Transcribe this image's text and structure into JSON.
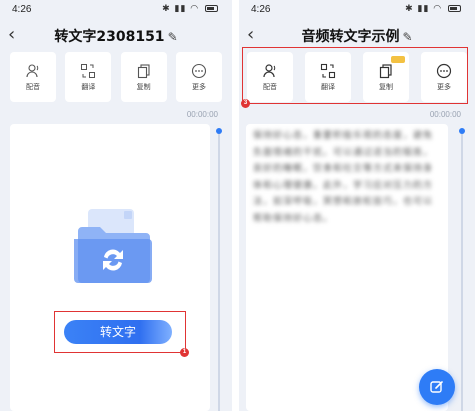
{
  "left_screen": {
    "status_time": "4:26",
    "title": "转文字2308151",
    "toolbar": [
      {
        "label": "配音",
        "icon": "person-voice-icon"
      },
      {
        "label": "翻译",
        "icon": "translate-icon"
      },
      {
        "label": "复制",
        "icon": "copy-icon"
      },
      {
        "label": "更多",
        "icon": "more-icon"
      }
    ],
    "timestamp": "00:00:00",
    "convert_label": "转文字",
    "badge": "1"
  },
  "right_screen": {
    "status_time": "4:26",
    "title": "音频转文字示例",
    "toolbar": [
      {
        "label": "配音",
        "icon": "person-voice-icon"
      },
      {
        "label": "翻译",
        "icon": "translate-icon"
      },
      {
        "label": "复制",
        "icon": "copy-icon"
      },
      {
        "label": "更多",
        "icon": "more-icon"
      }
    ],
    "timestamp": "00:00:00",
    "transcript": "保持好心态，重要积极乐观的态度，避免负面情绪的干扰。可以通过适当的锻炼，良好的睡眠，饮食和社交等方式来保持身体和心理健康。此外，学习应对压力的方法，如深呼吸，冥想和放松技巧，也可以帮助保持好心态。",
    "badge": "3"
  },
  "colors": {
    "accent": "#2e7cf6",
    "highlight": "#e03434",
    "background": "#eef1f7",
    "vip": "#f3c142"
  }
}
